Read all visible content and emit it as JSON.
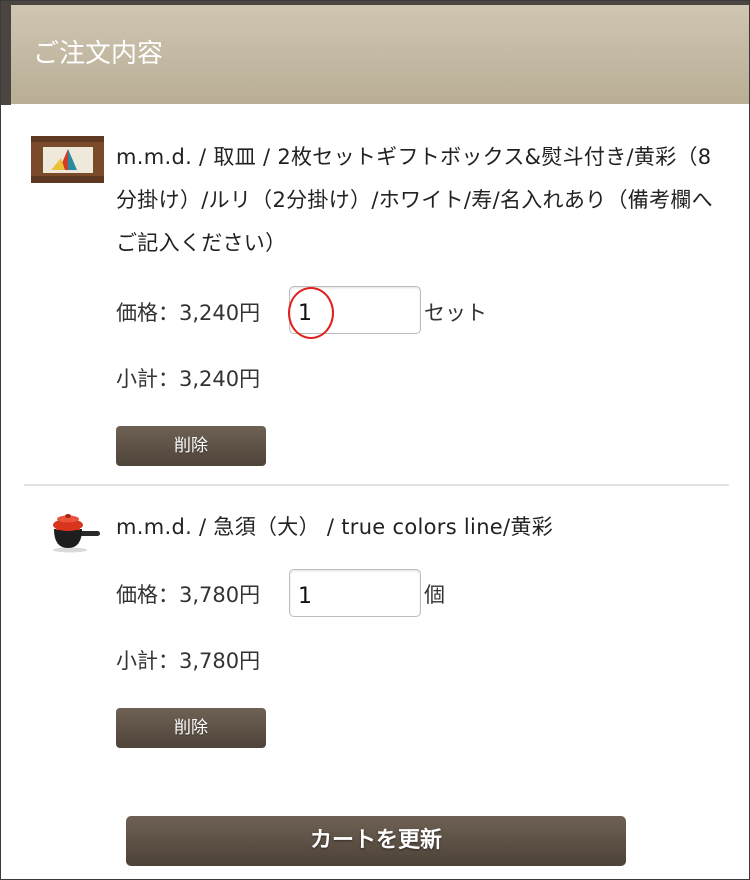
{
  "header": {
    "title": "ご注文内容"
  },
  "items": [
    {
      "name": "m.m.d. / 取皿 / 2枚セットギフトボックス&熨斗付き/黄彩（8分掛け）/ルリ（2分掛け）/ホワイト/寿/名入れあり（備考欄へご記入ください）",
      "price": "価格：3,240円",
      "quantity": "1",
      "unit": "セット",
      "subtotal": "小計：3,240円",
      "delete_label": "削除"
    },
    {
      "name": "m.m.d. / 急須（大） / true colors line/黄彩",
      "price": "価格：3,780円",
      "quantity": "1",
      "unit": "個",
      "subtotal": "小計：3,780円",
      "delete_label": "削除"
    }
  ],
  "update_button": {
    "label": "カートを更新"
  },
  "colors": {
    "header_bg": "#c4baa4",
    "button_bg": "#5c5046",
    "highlight": "#e0201d"
  }
}
